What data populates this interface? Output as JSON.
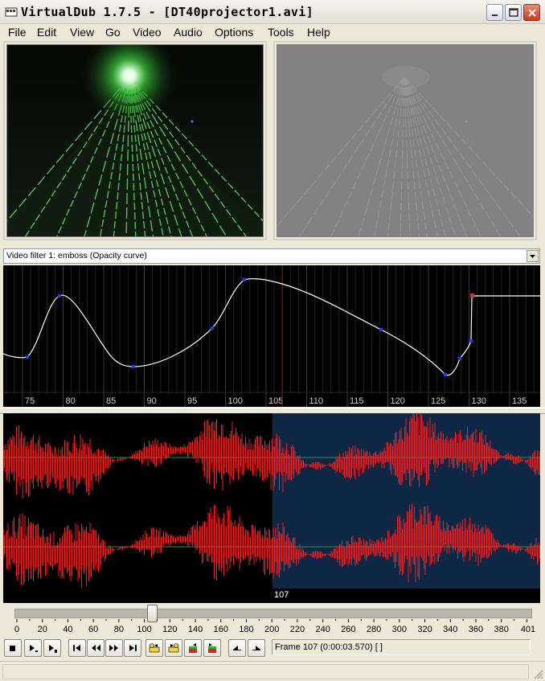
{
  "window": {
    "title": "VirtualDub 1.7.5 - [DT40projector1.avi]",
    "controls": [
      "minimize",
      "maximize",
      "close"
    ]
  },
  "menu": [
    "File",
    "Edit",
    "View",
    "Go",
    "Video",
    "Audio",
    "Options",
    "Tools",
    "Help"
  ],
  "filter_dropdown": {
    "selected": "Video filter 1: emboss (Opacity curve)"
  },
  "curve_editor": {
    "axis_labels": [
      "75",
      "80",
      "85",
      "90",
      "95",
      "100",
      "105",
      "110",
      "115",
      "120",
      "125",
      "130",
      "135"
    ],
    "current_frame": 107,
    "colors": {
      "curve": "#ffffff",
      "points": "#1f3cff",
      "selected_point": "#ff2020",
      "cursor": "#9a1010"
    }
  },
  "audio_display": {
    "position_label": "107",
    "colors": {
      "waveform": "#ff1a1a",
      "selection_bg": "#0d2744",
      "centerline": "#2e8b57"
    }
  },
  "timeline": {
    "ticks": [
      "0",
      "20",
      "40",
      "60",
      "80",
      "100",
      "120",
      "140",
      "160",
      "180",
      "200",
      "220",
      "240",
      "260",
      "280",
      "300",
      "320",
      "340",
      "360",
      "380",
      "401"
    ],
    "max_frame": 401,
    "position": 107
  },
  "toolbar": {
    "buttons": [
      "stop",
      "play-input",
      "play-output",
      "start",
      "back",
      "forward",
      "end",
      "prev-keyframe",
      "next-keyframe",
      "scene-back",
      "scene-forward",
      "mark-in",
      "mark-out"
    ],
    "frame_info": "Frame 107 (0:00:03.570) [ ]"
  }
}
